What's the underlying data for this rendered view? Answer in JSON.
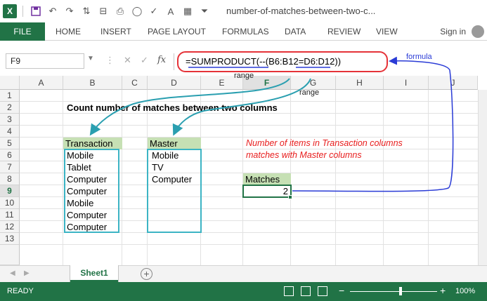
{
  "app": {
    "title": "number-of-matches-between-two-c...",
    "brand_color": "#217346"
  },
  "ribbon": {
    "tabs": [
      "FILE",
      "HOME",
      "INSERT",
      "PAGE LAYOUT",
      "FORMULAS",
      "DATA",
      "REVIEW",
      "VIEW"
    ],
    "active": "FILE",
    "signin": "Sign in"
  },
  "formula_bar": {
    "name_box": "F9",
    "fx": "fx",
    "formula": "=SUMPRODUCT(--(B6:B12=D6:D12))"
  },
  "grid": {
    "columns": [
      "A",
      "B",
      "C",
      "D",
      "E",
      "F",
      "G",
      "H",
      "I",
      "J"
    ],
    "rows": [
      "1",
      "2",
      "3",
      "4",
      "5",
      "6",
      "7",
      "8",
      "9",
      "10",
      "11",
      "12",
      "13"
    ],
    "selected_cell": "F9"
  },
  "sheet": {
    "title": "Count number of matches between two columns",
    "transaction_header": "Transaction",
    "transaction": [
      "Mobile",
      "Tablet",
      "Computer",
      "Computer",
      "Mobile",
      "Computer",
      "Computer"
    ],
    "master_header": "Master",
    "master": [
      "Mobile",
      "TV",
      "Computer"
    ],
    "note_line1": "Number of items in Transaction columns",
    "note_line2": "matches with Master columns",
    "matches_header": "Matches",
    "matches_value": "2"
  },
  "annotations": {
    "range1": "range",
    "range2": "range",
    "formula": "formula",
    "arrow_blue": "#2a3bd6",
    "arrow_teal": "#2a9fb0",
    "box_red": "#e53238"
  },
  "sheet_tabs": {
    "active": "Sheet1",
    "add": "+"
  },
  "status": {
    "text": "READY",
    "zoom": "100%"
  }
}
